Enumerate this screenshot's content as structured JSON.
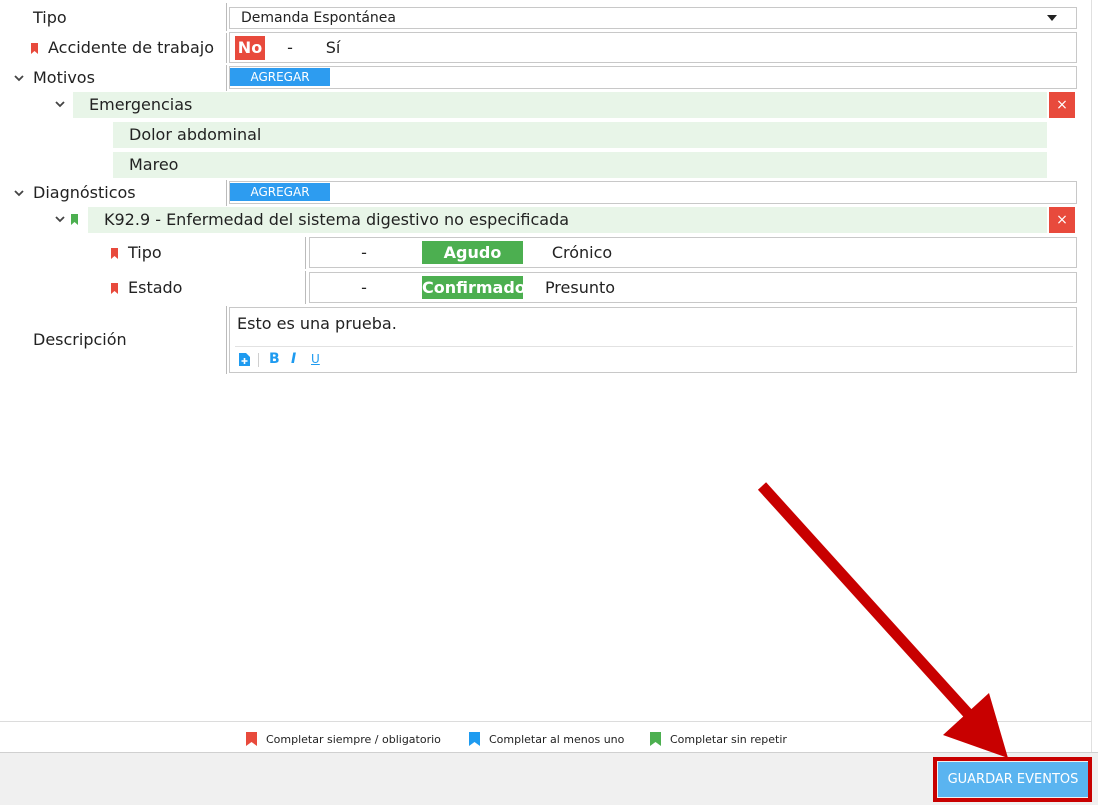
{
  "tipo": {
    "label": "Tipo",
    "value": "Demanda Espontánea"
  },
  "accidente": {
    "label": "Accidente de trabajo",
    "opt_no": "No",
    "sep": "-",
    "opt_si": "Sí"
  },
  "motivos": {
    "label": "Motivos",
    "add_label": "AGREGAR",
    "group": {
      "name": "Emergencias",
      "remove": "×",
      "items": [
        "Dolor abdominal",
        "Mareo"
      ]
    }
  },
  "diagnosticos": {
    "label": "Diagnósticos",
    "add_label": "AGREGAR",
    "item": {
      "name": "K92.9 - Enfermedad del sistema digestivo no especificada",
      "remove": "×",
      "tipo": {
        "label": "Tipo",
        "sep": "-",
        "opt_selected": "Agudo",
        "opt_other": "Crónico"
      },
      "estado": {
        "label": "Estado",
        "sep": "-",
        "opt_selected": "Confirmado",
        "opt_other": "Presunto"
      }
    }
  },
  "descripcion": {
    "label": "Descripción",
    "text": "Esto es una prueba."
  },
  "toolbar": {
    "bold": "B",
    "italic": "I",
    "underline": "U"
  },
  "legend": {
    "red": "Completar siempre / obligatorio",
    "blue": "Completar al menos uno",
    "green": "Completar sin repetir"
  },
  "footer": {
    "save_label": "GUARDAR EVENTOS"
  },
  "colors": {
    "red": "#e84a3c",
    "blue": "#1e9bf0",
    "green": "#4caf50",
    "annotation": "#c80000"
  }
}
